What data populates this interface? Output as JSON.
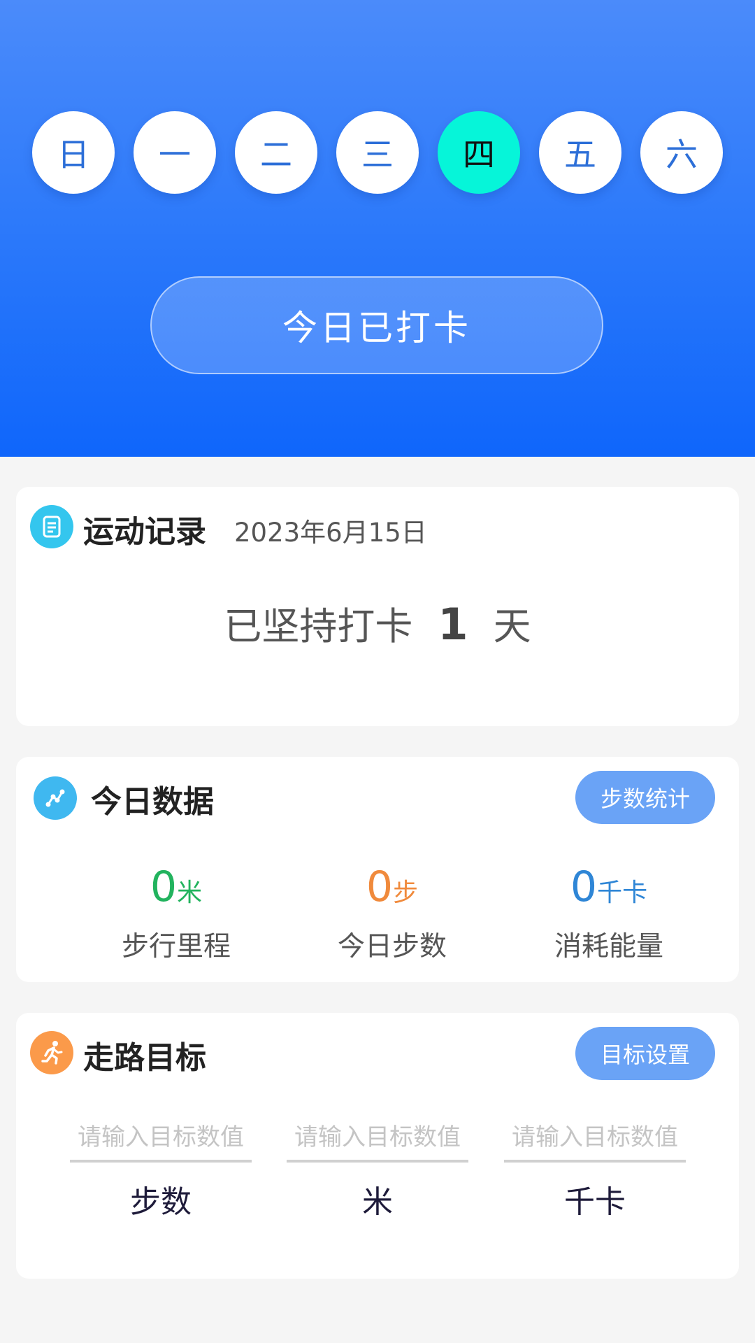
{
  "week": {
    "days": [
      {
        "label": "日",
        "active": false
      },
      {
        "label": "一",
        "active": false
      },
      {
        "label": "二",
        "active": false
      },
      {
        "label": "三",
        "active": false
      },
      {
        "label": "四",
        "active": true
      },
      {
        "label": "五",
        "active": false
      },
      {
        "label": "六",
        "active": false
      }
    ],
    "active_color": "#06f5d9"
  },
  "checkin": {
    "label": "今日已打卡"
  },
  "record": {
    "title": "运动记录",
    "date": "2023年6月15日",
    "streak_prefix": "已坚持打卡",
    "streak_days": "1",
    "streak_suffix": "天",
    "icon": "document-icon"
  },
  "today": {
    "title": "今日数据",
    "button": "步数统计",
    "icon": "chart-line-icon",
    "stats": [
      {
        "value": "0",
        "unit": "米",
        "label": "步行里程",
        "color": "#22b35e"
      },
      {
        "value": "0",
        "unit": "步",
        "label": "今日步数",
        "color": "#f08a3c"
      },
      {
        "value": "0",
        "unit": "千卡",
        "label": "消耗能量",
        "color": "#2f86d6"
      }
    ]
  },
  "goals": {
    "title": "走路目标",
    "button": "目标设置",
    "icon": "running-icon",
    "fields": [
      {
        "placeholder": "请输入目标数值",
        "value": "",
        "label": "步数"
      },
      {
        "placeholder": "请输入目标数值",
        "value": "",
        "label": "米"
      },
      {
        "placeholder": "请输入目标数值",
        "value": "",
        "label": "千卡"
      }
    ]
  }
}
